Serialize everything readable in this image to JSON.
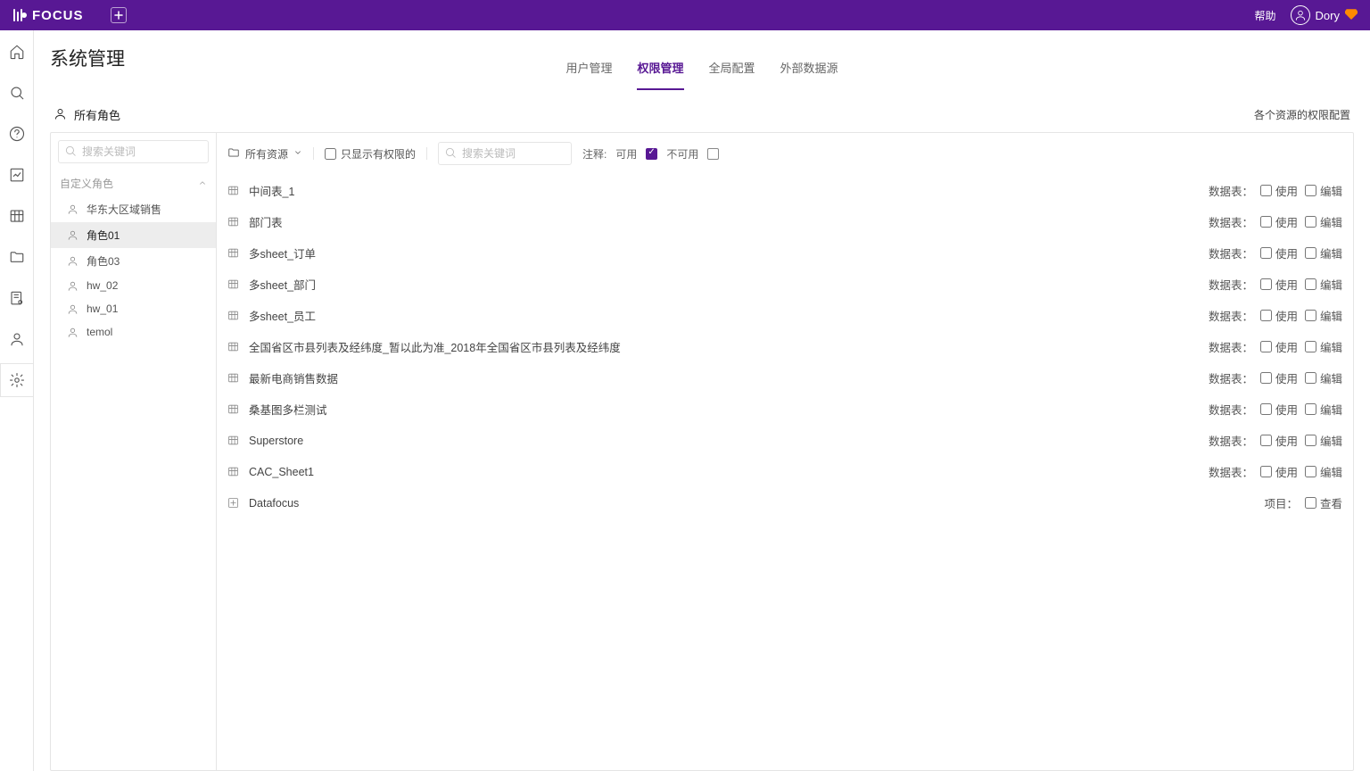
{
  "topbar": {
    "brand": "FOCUS",
    "help": "帮助",
    "user": "Dory"
  },
  "page": {
    "title": "系统管理",
    "tabs": [
      "用户管理",
      "权限管理",
      "全局配置",
      "外部数据源"
    ],
    "active_tab": 1
  },
  "roles": {
    "header": "所有角色",
    "search_placeholder": "搜索关键词",
    "group_label": "自定义角色",
    "items": [
      "华东大区域销售",
      "角色01",
      "角色03",
      "hw_02",
      "hw_01",
      "temol"
    ],
    "selected_index": 1
  },
  "resources": {
    "header": "各个资源的权限配置",
    "dropdown_label": "所有资源",
    "only_with_perm_label": "只显示有权限的",
    "search_placeholder": "搜索关键词",
    "legend_prefix": "注释:",
    "legend_available": "可用",
    "legend_unavailable": "不可用",
    "perm_table_prefix": "数据表：",
    "perm_project_prefix": "项目：",
    "perm_use": "使用",
    "perm_edit": "编辑",
    "perm_view": "查看",
    "rows": [
      {
        "type": "table",
        "name": "中间表_1"
      },
      {
        "type": "table",
        "name": "部门表"
      },
      {
        "type": "table",
        "name": "多sheet_订单"
      },
      {
        "type": "table",
        "name": "多sheet_部门"
      },
      {
        "type": "table",
        "name": "多sheet_员工"
      },
      {
        "type": "table",
        "name": "全国省区市县列表及经纬度_暂以此为准_2018年全国省区市县列表及经纬度"
      },
      {
        "type": "table",
        "name": "最新电商销售数据"
      },
      {
        "type": "table",
        "name": "桑基图多栏测试"
      },
      {
        "type": "table",
        "name": "Superstore"
      },
      {
        "type": "table",
        "name": "CAC_Sheet1"
      },
      {
        "type": "project",
        "name": "Datafocus"
      }
    ]
  }
}
